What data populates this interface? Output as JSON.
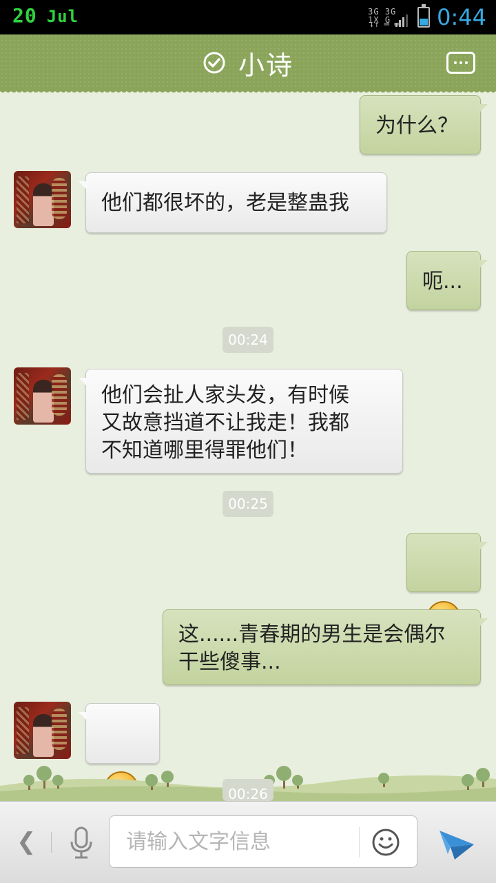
{
  "status_bar": {
    "day": "20",
    "month": "Jul",
    "network": "3G 3G 1X G",
    "time": "0:44"
  },
  "header": {
    "title": "小诗"
  },
  "messages": [
    {
      "side": "out",
      "text": "为什么？"
    },
    {
      "side": "in",
      "text": "他们都很坏的，老是整蛊我"
    },
    {
      "side": "out",
      "text": "呃..."
    },
    {
      "side": "time",
      "text": "00:24"
    },
    {
      "side": "in",
      "text": "他们会扯人家头发，有时候\n又故意挡道不让我走！我都\n不知道哪里得罪他们！"
    },
    {
      "side": "time",
      "text": "00:25"
    },
    {
      "side": "out",
      "emoji": "worried-face-icon"
    },
    {
      "side": "out",
      "text": "这......青春期的男生是会偶尔\n干些傻事..."
    },
    {
      "side": "in",
      "emoji": "shy-face-icon"
    },
    {
      "side": "time",
      "text": "00:26"
    }
  ],
  "input": {
    "placeholder": "请输入文字信息"
  },
  "colors": {
    "header": "#8aa55a",
    "background": "#e9efde",
    "out_bubble": "#c7d6a5",
    "in_bubble": "#f2f2f2",
    "time_accent": "#36a9e1"
  }
}
